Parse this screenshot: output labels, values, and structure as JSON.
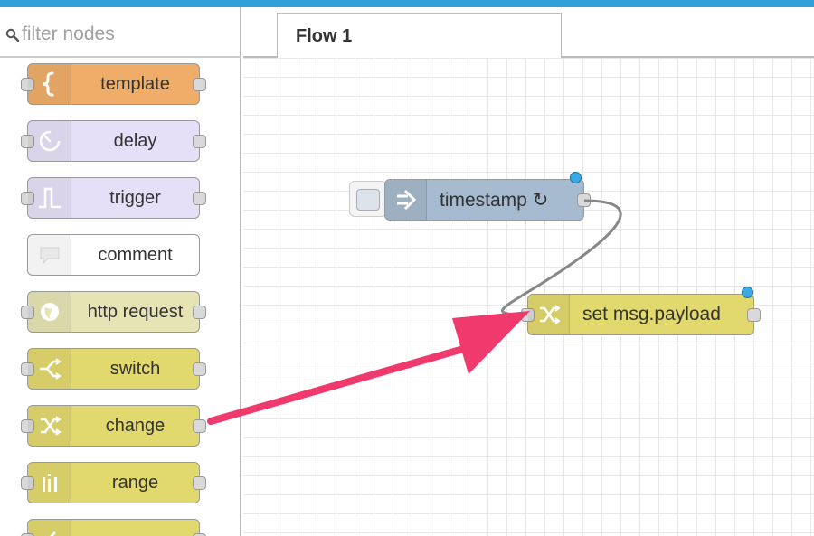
{
  "palette": {
    "filter_placeholder": "filter nodes",
    "nodes": [
      {
        "label": "template",
        "icon": "curly-brace-icon",
        "color": "#efad69"
      },
      {
        "label": "delay",
        "icon": "timer-icon",
        "color": "#e5e0f7"
      },
      {
        "label": "trigger",
        "icon": "trigger-pulse-icon",
        "color": "#e5e0f7"
      },
      {
        "label": "comment",
        "icon": "comment-bubble-icon",
        "color": "#ffffff"
      },
      {
        "label": "http request",
        "icon": "globe-icon",
        "color": "#e6e4b5"
      },
      {
        "label": "switch",
        "icon": "switch-icon",
        "color": "#e2d96e"
      },
      {
        "label": "change",
        "icon": "shuffle-icon",
        "color": "#e2d96e"
      },
      {
        "label": "range",
        "icon": "range-icon",
        "color": "#e2d96e"
      },
      {
        "label": "",
        "icon": "split-icon",
        "color": "#e2d96e"
      }
    ]
  },
  "workspace": {
    "tab_label": "Flow 1",
    "nodes": {
      "timestamp": {
        "label": "timestamp ↻",
        "icon": "arrow-right-icon",
        "color": "#a6bbcf"
      },
      "change": {
        "label": "set msg.payload",
        "icon": "shuffle-icon",
        "color": "#e2d96e"
      }
    }
  },
  "colors": {
    "topbar": "#2d9fd9",
    "annotation_arrow": "#f03a6e",
    "wire": "#888888",
    "changed_dot": "#3ba9e5"
  }
}
